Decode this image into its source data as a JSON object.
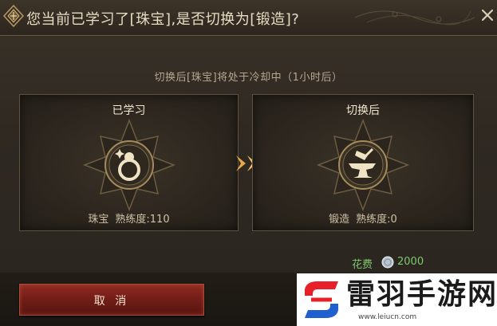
{
  "dialog": {
    "title": "您当前已学习了[珠宝],是否切换为[锻造]?",
    "subtitle": "切换后[珠宝]将处于冷却中（1小时后）",
    "close_icon": "close-x-icon"
  },
  "left_panel": {
    "header": "已学习",
    "skill_name": "珠宝",
    "proficiency": "熟练度:110",
    "icon": "ring-icon"
  },
  "right_panel": {
    "header": "切换后",
    "skill_name": "锻造",
    "proficiency": "熟练度:0",
    "icon": "anvil-icon"
  },
  "cost": {
    "label": "花费",
    "icon": "silver-coin-icon",
    "value": "2000",
    "color": "#7fc86c"
  },
  "buttons": {
    "cancel_label": "取 消"
  },
  "watermark": {
    "name": "雷羽手游网",
    "url": "www.leiucn.com"
  },
  "colors": {
    "accent_gold": "#e8b25a",
    "cancel_red": "#8e2a21"
  }
}
